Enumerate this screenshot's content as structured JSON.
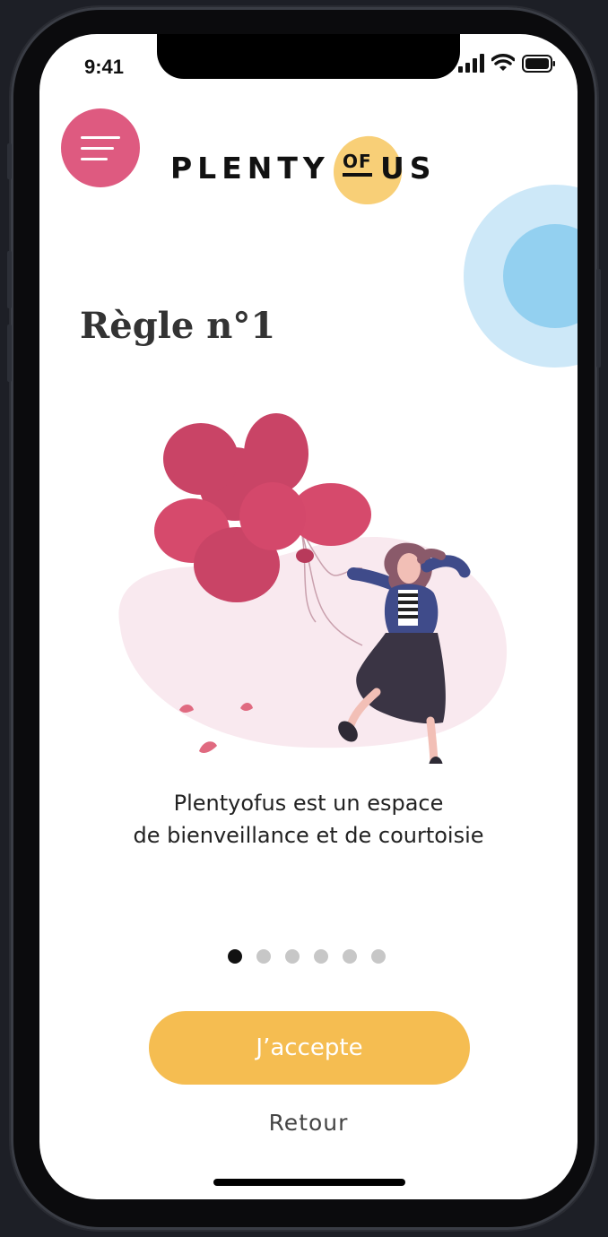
{
  "status_bar": {
    "time": "9:41",
    "icons": [
      "cellular-signal-icon",
      "wifi-icon",
      "battery-icon"
    ]
  },
  "header": {
    "menu_icon": "hamburger-menu-icon",
    "logo": {
      "part1": "PLENTY",
      "part2": "OF",
      "part3": "US"
    }
  },
  "content": {
    "rule_title": "Règle n°1",
    "description_line1": "Plentyofus est un espace",
    "description_line2": "de bienveillance et de courtoisie"
  },
  "pagination": {
    "total": 6,
    "current": 1
  },
  "actions": {
    "accept_label": "J’accepte",
    "back_label": "Retour"
  },
  "colors": {
    "menu_button": "#de5a80",
    "accept_button": "#f5bd51",
    "logo_blob": "#f8cf77",
    "balloon": "#d64a6c",
    "blob_background": "#f9e9ef",
    "deco_outer": "#cde8f8",
    "deco_inner": "#93d0f0",
    "jacket": "#3f4b8a",
    "skirt": "#3a3444",
    "hair": "#8a5a6a",
    "skin": "#f2bfb6"
  }
}
